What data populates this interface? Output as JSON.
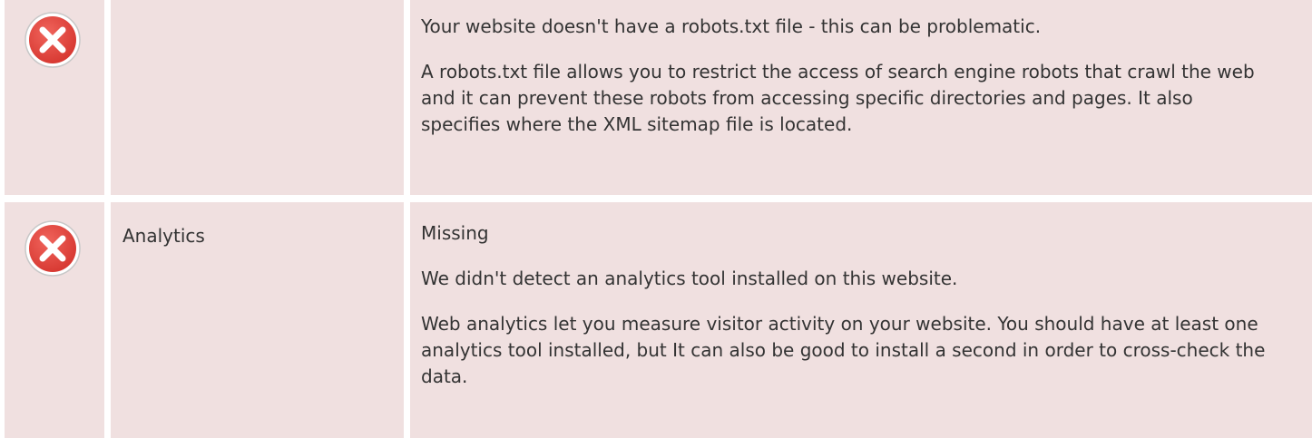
{
  "accent_colors": {
    "error_red": "#e64540",
    "row_background": "#f0e0e0"
  },
  "rows": [
    {
      "status_icon": "error-x-icon",
      "label": "",
      "paragraphs": [
        "Your website doesn't have a robots.txt file - this can be problematic.",
        "A robots.txt file allows you to restrict the access of search engine robots that crawl the web and it can prevent these robots from accessing specific directories and pages. It also specifies where the XML sitemap file is located."
      ]
    },
    {
      "status_icon": "error-x-icon",
      "label": "Analytics",
      "paragraphs": [
        "Missing",
        "We didn't detect an analytics tool installed on this website.",
        "Web analytics let you measure visitor activity on your website. You should have at least one analytics tool installed, but It can also be good to install a second in order to cross-check the data."
      ]
    }
  ]
}
